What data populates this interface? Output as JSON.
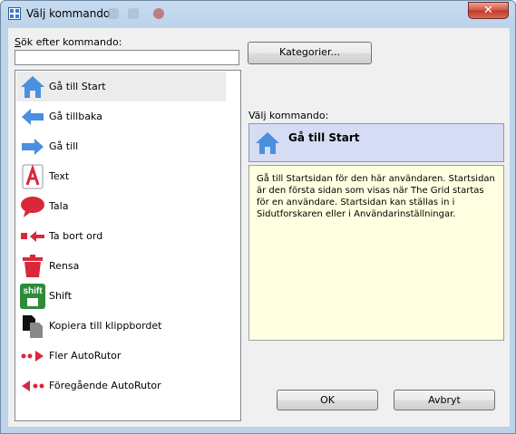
{
  "window": {
    "title": "Välj kommando",
    "close_glyph": "✕"
  },
  "search": {
    "label": "Sök efter kommando:",
    "value": "",
    "placeholder": ""
  },
  "categories_button": "Kategorier...",
  "commands": [
    {
      "label": "Gå till Start",
      "icon": "home-icon",
      "selected": true
    },
    {
      "label": "Gå tillbaka",
      "icon": "arrow-left-icon"
    },
    {
      "label": "Gå till",
      "icon": "arrow-right-icon"
    },
    {
      "label": "Text",
      "icon": "text-a-icon"
    },
    {
      "label": "Tala",
      "icon": "speech-bubble-icon"
    },
    {
      "label": "Ta bort ord",
      "icon": "delete-word-icon"
    },
    {
      "label": "Rensa",
      "icon": "trash-icon"
    },
    {
      "label": "Shift",
      "icon": "shift-key-icon",
      "icon_text": "shift"
    },
    {
      "label": "Kopiera till klippbordet",
      "icon": "copy-icon"
    },
    {
      "label": "Fler AutoRutor",
      "icon": "more-cells-icon"
    },
    {
      "label": "Föregående AutoRutor",
      "icon": "previous-cells-icon"
    }
  ],
  "selected_panel": {
    "label": "Välj kommando:",
    "name": "Gå till Start",
    "description": "Gå till Startsidan för den här användaren. Startsidan är den första sidan som visas när The Grid startas för en användare. Startsidan kan ställas in i Sidutforskaren eller i Användarinställningar."
  },
  "buttons": {
    "ok": "OK",
    "cancel": "Avbryt"
  },
  "colors": {
    "icon_blue": "#4a8fe0",
    "icon_red": "#d9283a",
    "shift_green": "#2e8b3a",
    "selection_bg": "#d6dcf3",
    "description_bg": "#ffffe1"
  }
}
